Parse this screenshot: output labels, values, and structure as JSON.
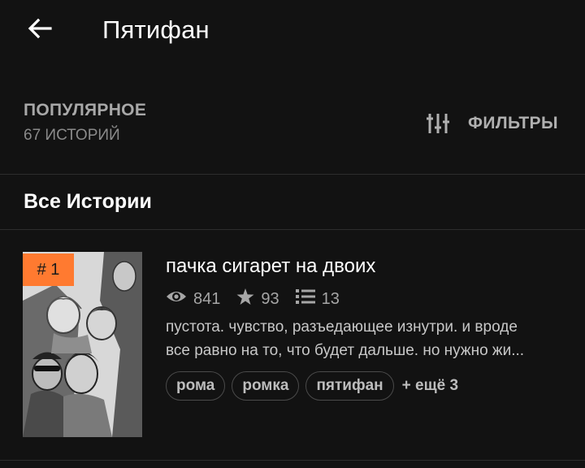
{
  "header": {
    "back_icon": "arrow-left-icon",
    "title": "Пятифан"
  },
  "section": {
    "sort_label": "ПОПУЛЯРНОЕ",
    "count_label": "67 ИСТОРИЙ",
    "filters_icon": "sliders-icon",
    "filters_label": "ФИЛЬТРЫ"
  },
  "list": {
    "heading": "Все Истории"
  },
  "stories": [
    {
      "rank": "# 1",
      "title": "пачка сигарет на двоих",
      "views": "841",
      "votes": "93",
      "parts": "13",
      "description_lines": [
        "пустота. чувство, разъедающее изнутри. и вроде",
        "все равно на то, что будет дальше. но нужно жи..."
      ],
      "tags": [
        "рома",
        "ромка",
        "пятифан"
      ],
      "more_tags": "+ ещё 3"
    }
  ],
  "colors": {
    "background": "#121212",
    "badge": "#ff7a30",
    "divider": "#2d2d2d",
    "muted_text": "#a6a6a6"
  }
}
